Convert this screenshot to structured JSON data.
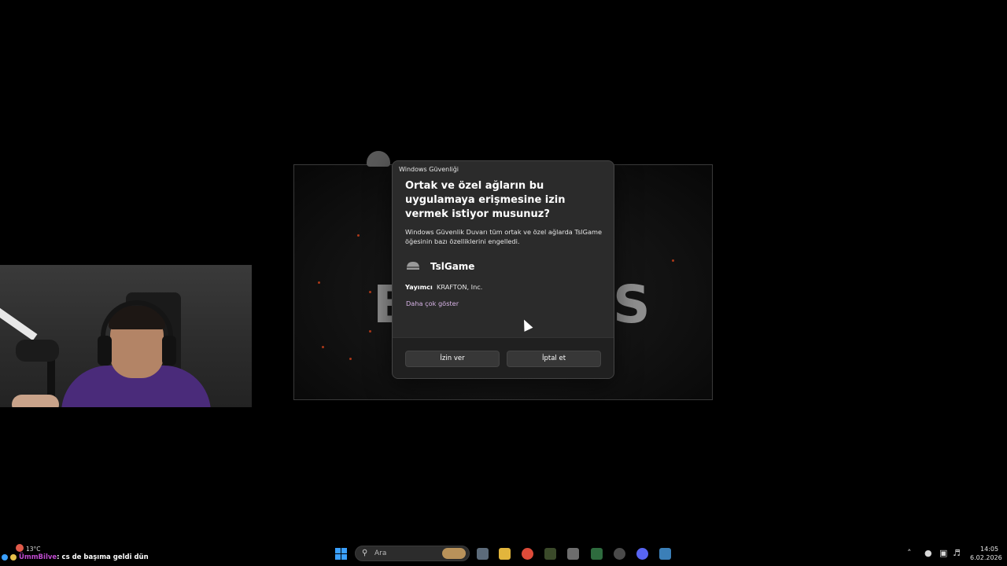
{
  "dialog": {
    "app_title": "Windows Güvenliği",
    "heading": "Ortak ve özel ağların bu uygulamaya erişmesine izin vermek istiyor musunuz?",
    "description": "Windows Güvenlik Duvarı tüm ortak ve özel ağlarda TslGame öğesinin bazı özelliklerini engelledi.",
    "app_name": "TslGame",
    "publisher_label": "Yayımcı",
    "publisher_value": "KRAFTON, Inc.",
    "more_link": "Daha çok göster",
    "allow_button": "İzin ver",
    "cancel_button": "İptal et"
  },
  "game": {
    "logo_left": "B",
    "logo_right": "S"
  },
  "chat": {
    "username": "ÜmmBilve",
    "message": ": cs de başıma geldi dün"
  },
  "weather": {
    "temperature": "13°C"
  },
  "taskbar": {
    "search_placeholder": "Ara",
    "time": "14:05",
    "date": "6.02.2026"
  },
  "colors": {
    "accent_link": "#d7b3e6",
    "dialog_bg": "#2b2b2b",
    "windows_blue": "#3aa0ff"
  }
}
